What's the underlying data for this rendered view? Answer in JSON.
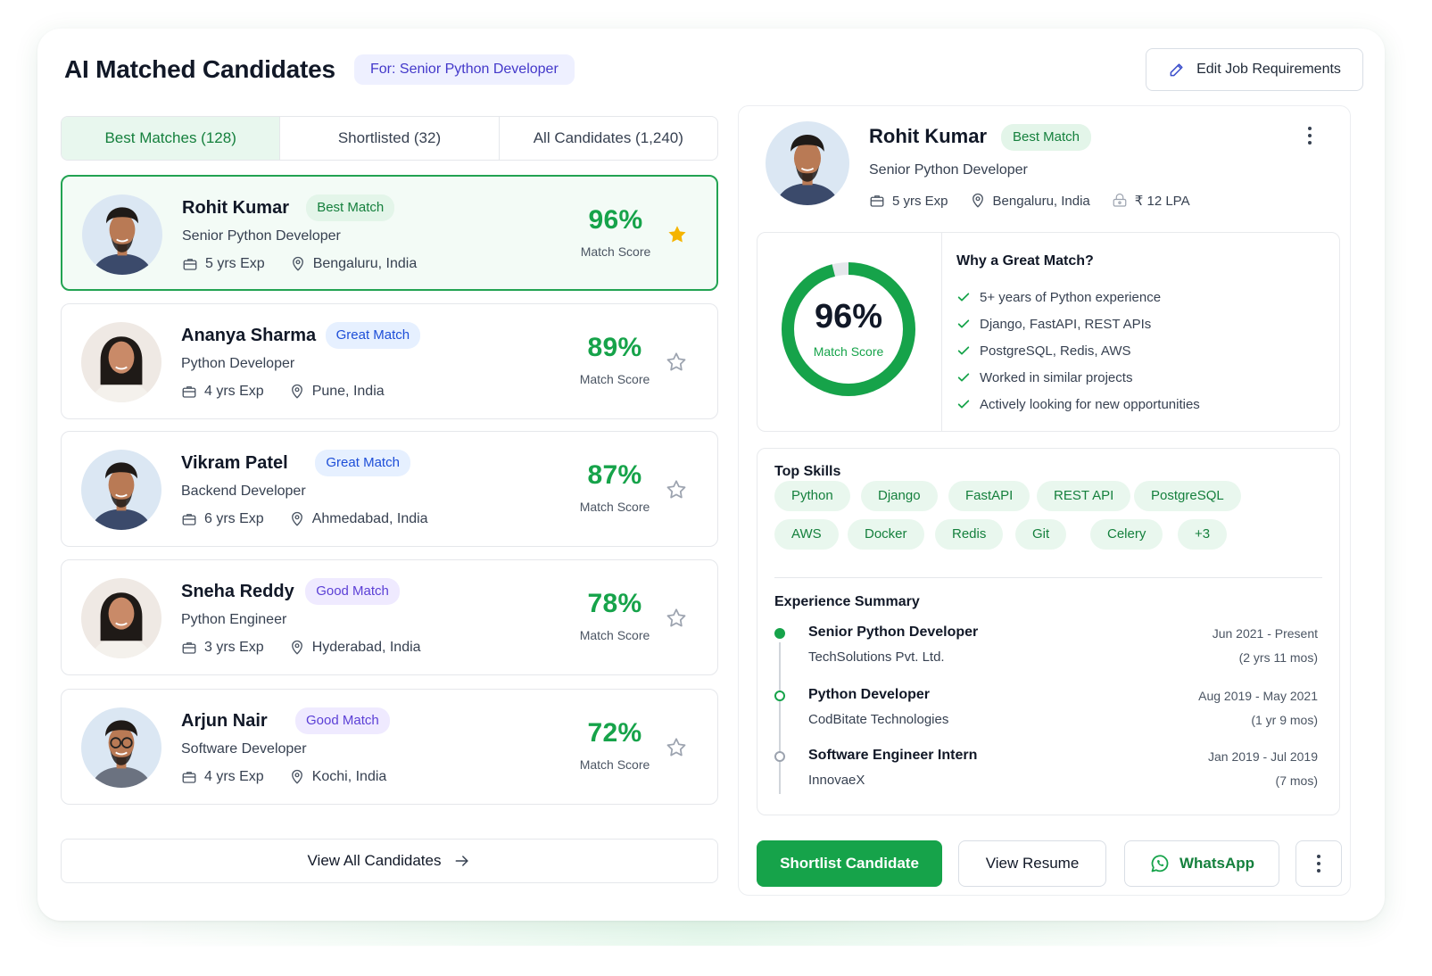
{
  "header": {
    "title": "AI Matched Candidates",
    "job_pill": "For: Senior Python Developer",
    "edit_button": "Edit Job Requirements"
  },
  "tabs": [
    {
      "label": "Best Matches (128)",
      "active": true
    },
    {
      "label": "Shortlisted (32)",
      "active": false
    },
    {
      "label": "All Candidates (1,240)",
      "active": false
    }
  ],
  "candidates": [
    {
      "name": "Rohit Kumar",
      "badge": "Best Match",
      "badge_type": "best",
      "role": "Senior Python Developer",
      "exp": "5 yrs Exp",
      "location": "Bengaluru, India",
      "score": "96%",
      "score_label": "Match Score",
      "starred": true,
      "selected": true
    },
    {
      "name": "Ananya Sharma",
      "badge": "Great Match",
      "badge_type": "great",
      "role": "Python Developer",
      "exp": "4 yrs Exp",
      "location": "Pune, India",
      "score": "89%",
      "score_label": "Match Score",
      "starred": false,
      "selected": false
    },
    {
      "name": "Vikram Patel",
      "badge": "Great Match",
      "badge_type": "great",
      "role": "Backend Developer",
      "exp": "6 yrs Exp",
      "location": "Ahmedabad, India",
      "score": "87%",
      "score_label": "Match Score",
      "starred": false,
      "selected": false
    },
    {
      "name": "Sneha Reddy",
      "badge": "Good Match",
      "badge_type": "good",
      "role": "Python Engineer",
      "exp": "3 yrs Exp",
      "location": "Hyderabad, India",
      "score": "78%",
      "score_label": "Match Score",
      "starred": false,
      "selected": false
    },
    {
      "name": "Arjun Nair",
      "badge": "Good Match",
      "badge_type": "good",
      "role": "Software Developer",
      "exp": "4 yrs Exp",
      "location": "Kochi, India",
      "score": "72%",
      "score_label": "Match Score",
      "starred": false,
      "selected": false
    }
  ],
  "view_all": "View All Candidates",
  "detail": {
    "name": "Rohit Kumar",
    "badge": "Best Match",
    "role": "Senior Python Developer",
    "exp": "5 yrs Exp",
    "location": "Bengaluru, India",
    "salary": "₹ 12 LPA",
    "match_value": "96%",
    "match_fraction": 0.96,
    "match_label": "Match Score",
    "why_title": "Why a Great Match?",
    "why": [
      "5+ years of Python experience",
      "Django, FastAPI, REST APIs",
      "PostgreSQL, Redis, AWS",
      "Worked in similar projects",
      "Actively looking for new opportunities"
    ],
    "skills_title": "Top Skills",
    "skills": [
      "Python",
      "Django",
      "FastAPI",
      "REST API",
      "PostgreSQL",
      "AWS",
      "Docker",
      "Redis",
      "Git",
      "Celery",
      "+3"
    ],
    "experience_title": "Experience Summary",
    "experience": [
      {
        "title": "Senior Python Developer",
        "company": "TechSolutions Pvt. Ltd.",
        "dates": "Jun 2021 - Present",
        "duration": "(2 yrs 11 mos)"
      },
      {
        "title": "Python Developer",
        "company": "CodBitate Technologies",
        "dates": "Aug 2019 - May 2021",
        "duration": "(1 yr 9 mos)"
      },
      {
        "title": "Software Engineer Intern",
        "company": "InnovaeX",
        "dates": "Jan 2019 - Jul 2019",
        "duration": "(7 mos)"
      }
    ],
    "actions": {
      "shortlist": "Shortlist Candidate",
      "resume": "View Resume",
      "whatsapp": "WhatsApp"
    }
  },
  "colors": {
    "accent": "#16a34a",
    "accent_light": "#e3f5e9",
    "great_badge": "#1d4ed8",
    "good_badge": "#5b3fd6",
    "star": "#f5b400"
  }
}
